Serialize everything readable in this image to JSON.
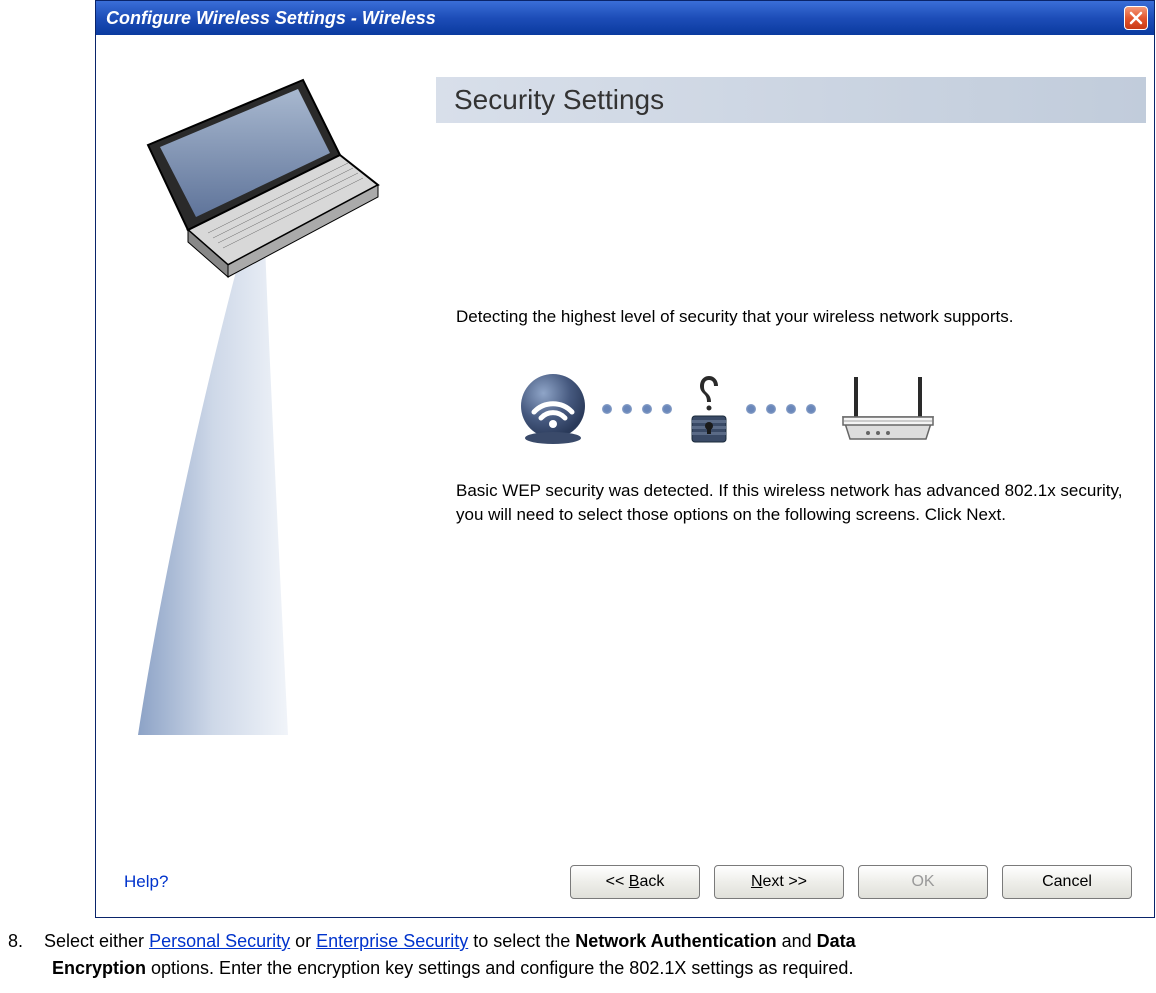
{
  "dialog": {
    "title": "Configure Wireless Settings  -  Wireless",
    "header": "Security Settings",
    "detect_text": "Detecting the highest level of security that your wireless network supports.",
    "result_text": "Basic WEP security was detected. If this wireless network has advanced 802.1x security, you will need to select those options on the following screens. Click Next.",
    "help_label": "Help?",
    "buttons": {
      "back": "<< Back",
      "back_underline": "B",
      "next_prefix": "",
      "next_underline": "N",
      "next_suffix": "ext >>",
      "ok": "OK",
      "cancel": "Cancel"
    }
  },
  "instruction": {
    "number": "8.",
    "prefix": "Select either ",
    "link1": "Personal Security",
    "mid1": " or ",
    "link2": "Enterprise Security",
    "mid2": " to select the ",
    "bold1": "Network Authentication",
    "mid3": " and ",
    "bold2": "Data Encryption",
    "suffix": " options. Enter the encryption key settings and configure the 802.1X settings as required."
  }
}
